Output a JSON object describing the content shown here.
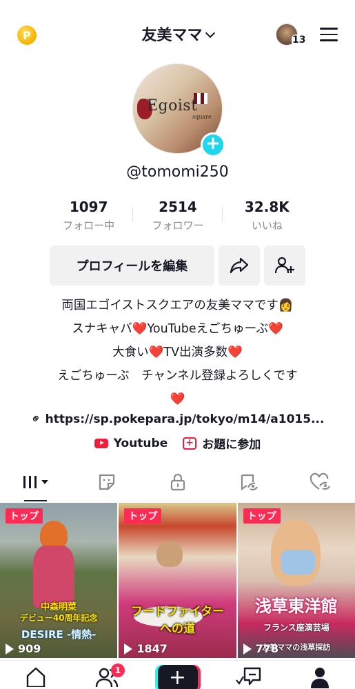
{
  "header": {
    "coin_label": "P",
    "account_name": "友美ママ",
    "friend_count": "13"
  },
  "profile": {
    "avatar_text": "Egoist",
    "avatar_subtext": "square",
    "username": "@tomomi250",
    "stats": [
      {
        "value": "1097",
        "label": "フォロー中"
      },
      {
        "value": "2514",
        "label": "フォロワー"
      },
      {
        "value": "32.8K",
        "label": "いいね"
      }
    ],
    "edit_button": "プロフィールを編集",
    "bio": [
      "両国エゴイストスクエアの友美ママです👩",
      "スナキャバ❤️YouTubeえごちゅーぶ❤️",
      "大食い❤️TV出演多数❤️",
      "えごちゅーぶ　チャンネル登録よろしくです",
      "❤️"
    ],
    "link": "https://sp.pokepara.jp/tokyo/m14/a1015...",
    "extras": [
      {
        "label": "Youtube"
      },
      {
        "label": "お題に参加"
      }
    ]
  },
  "videos": [
    {
      "badge": "トップ",
      "views": "909",
      "overlay_1": "中森明菜",
      "overlay_2": "デビュー40周年記念",
      "overlay_3": "DESIRE -情熱-"
    },
    {
      "badge": "トップ",
      "views": "1847",
      "overlay_1": "フードファイター",
      "overlay_2": "への道"
    },
    {
      "badge": "トップ",
      "views": "778",
      "overlay_1": "浅草東洋館",
      "overlay_2": "フランス座演芸場",
      "overlay_3": "友美ママの浅草探訪"
    }
  ],
  "nav": {
    "inbox_badge": "1"
  },
  "colors": {
    "accent_red": "#fe2c55",
    "accent_cyan": "#20d5ec",
    "heart": "#ee1d3a"
  }
}
